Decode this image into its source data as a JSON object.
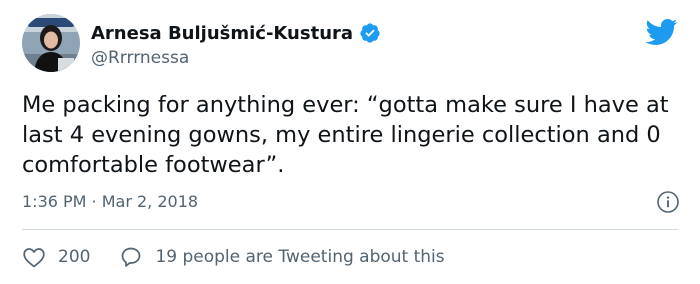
{
  "tweet": {
    "author": {
      "display_name": "Arnesa Buljušmić-Kustura",
      "handle": "@Rrrrnessa",
      "verified": true,
      "avatar_icon": "profile-photo"
    },
    "text": "Me packing for anything ever: “gotta make sure I have at last 4 evening gowns, my entire lingerie collection and 0 comfortable footwear”.",
    "timestamp": "1:36 PM · Mar 2, 2018",
    "likes": "200",
    "conversation": "19 people are Tweeting about this"
  },
  "icons": {
    "brand": "twitter-bird-icon",
    "verified": "verified-badge-icon",
    "info": "info-icon",
    "like": "heart-icon",
    "reply": "speech-bubble-icon"
  },
  "colors": {
    "brand_blue": "#1d9bf0",
    "text_primary": "#0f1419",
    "text_secondary": "#536471",
    "divider": "#cfd9de"
  }
}
